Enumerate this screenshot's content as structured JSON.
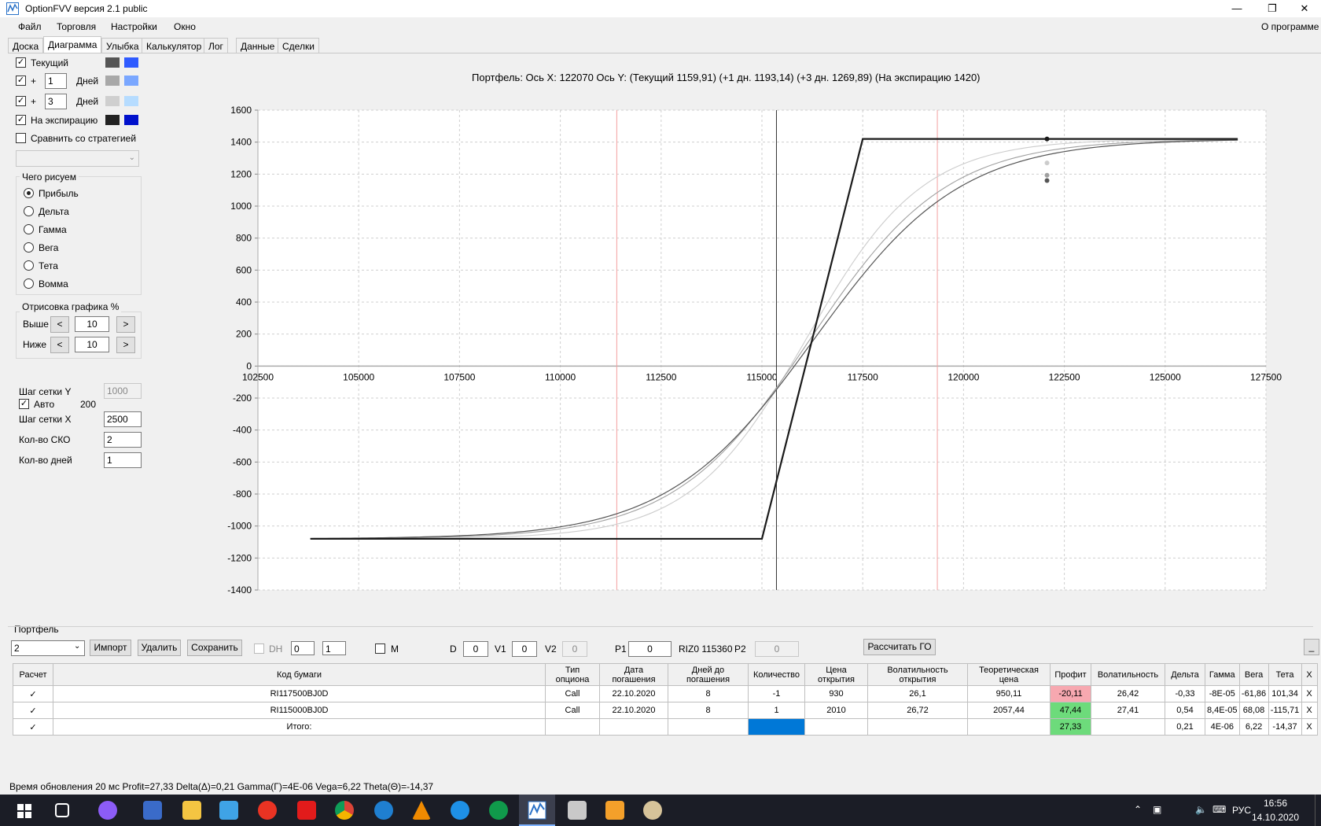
{
  "window": {
    "title": "OptionFVV версия 2.1 public",
    "min": "—",
    "restore": "❐",
    "close": "✕"
  },
  "menu": {
    "items": [
      "Файл",
      "Торговля",
      "Настройки",
      "Окно"
    ],
    "about": "О программе"
  },
  "tabs": [
    "Доска",
    "Диаграмма",
    "Улыбка",
    "Калькулятор",
    "Лог",
    "Данные",
    "Сделки"
  ],
  "left": {
    "current": "Текущий",
    "plus": "+",
    "days": "Дней",
    "days1": "1",
    "days2": "3",
    "expiry": "На экспирацию",
    "compare": "Сравнить со стратегией",
    "draw_group": "Чего рисуем",
    "draw_options": [
      "Прибыль",
      "Дельта",
      "Гамма",
      "Вега",
      "Тета",
      "Вомма"
    ],
    "render_group": "Отрисовка графика %",
    "above": "Выше",
    "below": "Ниже",
    "above_val": "10",
    "below_val": "10",
    "lt": "<",
    "gt": ">",
    "grid_y": "Шаг сетки Y",
    "grid_y_val": "1000",
    "auto": "Авто",
    "auto_val": "200",
    "grid_x": "Шаг сетки X",
    "grid_x_val": "2500",
    "sko": "Кол-во СКО",
    "sko_val": "2",
    "ndays": "Кол-во дней",
    "ndays_val": "1",
    "colors": {
      "current": [
        "#555555",
        "#2f5bff"
      ],
      "plus1": [
        "#a8a8a8",
        "#7aa7ff"
      ],
      "plus3": [
        "#cfcfcf",
        "#b6dcff"
      ],
      "expiry": [
        "#222222",
        "#0011cc"
      ]
    }
  },
  "chart_header": "Портфель: Ось X: 122070 Ось Y: (Текущий 1159,91) (+1 дн. 1193,14) (+3 дн. 1269,89) (На экспирацию 1420)",
  "chart_data": {
    "type": "line",
    "x_ticks": [
      102500,
      105000,
      107500,
      110000,
      112500,
      115000,
      117500,
      120000,
      122500,
      125000,
      127500
    ],
    "y_ticks": [
      -1400,
      -1200,
      -1000,
      -800,
      -600,
      -400,
      -200,
      0,
      200,
      400,
      600,
      800,
      1000,
      1200,
      1400,
      1600
    ],
    "xlim": [
      102500,
      127500
    ],
    "ylim": [
      -1400,
      1600
    ],
    "grid": true,
    "vertical_lines": {
      "cursor": 115360,
      "sigma_low": 111400,
      "sigma_high": 119350
    },
    "marker_x": 122070,
    "series": [
      {
        "name": "На экспирацию",
        "color": "#1a1a1a",
        "width": 2.2,
        "x": [
          103800,
          115000,
          117500,
          126800
        ],
        "y": [
          -1080,
          -1080,
          1420,
          1420
        ],
        "marker": 1420
      },
      {
        "name": "Текущий",
        "color": "#555555",
        "width": 1.2,
        "center": 116300,
        "scale": 2900,
        "xs": [
          103800,
          126800
        ],
        "low": -1080,
        "high": 1420,
        "marker": 1159.91
      },
      {
        "name": "+1 дн.",
        "color": "#a0a0a0",
        "width": 1.1,
        "center": 116200,
        "scale": 2700,
        "xs": [
          103800,
          126800
        ],
        "low": -1080,
        "high": 1420,
        "marker": 1193.14
      },
      {
        "name": "+3 дн.",
        "color": "#cccccc",
        "width": 1.1,
        "center": 116100,
        "scale": 2300,
        "xs": [
          103800,
          126800
        ],
        "low": -1080,
        "high": 1420,
        "marker": 1269.89
      }
    ]
  },
  "portfolio": {
    "label": "Портфель",
    "select_val": "2",
    "import": "Импорт",
    "delete": "Удалить",
    "save": "Сохранить",
    "dh": "DH",
    "spin1": "0",
    "spin2": "1",
    "m": "M",
    "d": "D",
    "d_val": "0",
    "v1": "V1",
    "v1_val": "0",
    "v2": "V2",
    "v2_val": "0",
    "p1": "P1",
    "p1_val": "0",
    "riz": "RIZ0 115360",
    "p2": "P2",
    "p2_val": "0",
    "calc_go": "Рассчитать ГО",
    "minimize": "_",
    "columns": [
      "Расчет",
      "Код бумаги",
      "Тип опциона",
      "Дата погашения",
      "Дней до погашения",
      "Количество",
      "Цена открытия",
      "Волатильность открытия",
      "Теоретическая цена",
      "Профит",
      "Волатильность",
      "Дельта",
      "Гамма",
      "Вега",
      "Тета",
      "X"
    ],
    "rows": [
      {
        "check": "✓",
        "code": "RI117500BJ0D",
        "type": "Call",
        "date": "22.10.2020",
        "days": "8",
        "qty": "-1",
        "open": "930",
        "vol_open": "26,1",
        "theo": "950,11",
        "profit": "-20,11",
        "vol": "26,42",
        "delta": "-0,33",
        "gamma": "-8E-05",
        "vega": "-61,86",
        "theta": "101,34",
        "x": "X"
      },
      {
        "check": "✓",
        "code": "RI115000BJ0D",
        "type": "Call",
        "date": "22.10.2020",
        "days": "8",
        "qty": "1",
        "open": "2010",
        "vol_open": "26,72",
        "theo": "2057,44",
        "profit": "47,44",
        "vol": "27,41",
        "delta": "0,54",
        "gamma": "8,4E-05",
        "vega": "68,08",
        "theta": "-115,71",
        "x": "X"
      }
    ],
    "total": {
      "check": "✓",
      "label": "Итого:",
      "profit": "27,33",
      "delta": "0,21",
      "gamma": "4E-06",
      "vega": "6,22",
      "theta": "-14,37",
      "x": "X"
    }
  },
  "status": "Время обновления 20 мс   Profit=27,33 Delta(Δ)=0,21 Gamma(Γ)=4E-06 Vega=6,22 Theta(Θ)=-14,37",
  "taskbar": {
    "lang": "РУС",
    "time": "16:56",
    "date": "14.10.2020"
  }
}
